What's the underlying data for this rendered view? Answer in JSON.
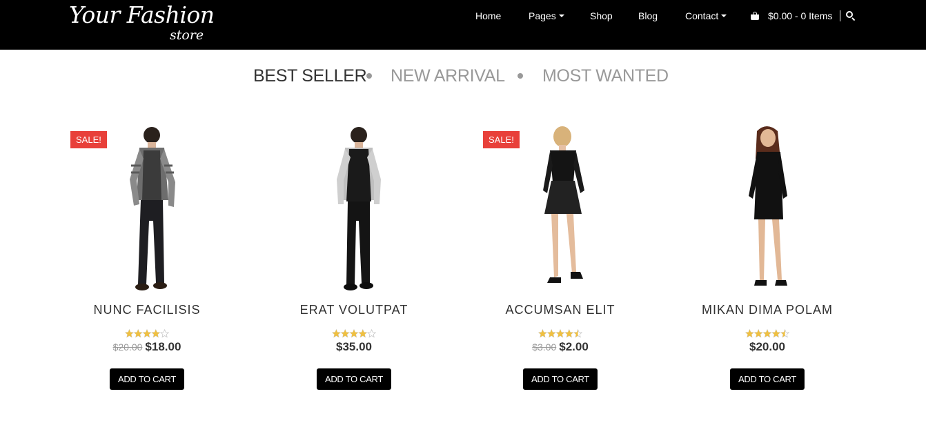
{
  "brand": {
    "logo_main": "Your Fashion",
    "logo_sub": "store"
  },
  "nav": {
    "home": "Home",
    "pages": "Pages",
    "shop": "Shop",
    "blog": "Blog",
    "contact": "Contact"
  },
  "cart": {
    "summary": "$0.00 - 0 Items"
  },
  "tabs": {
    "best_seller": "BEST SELLER",
    "new_arrival": "NEW ARRIVAL",
    "most_wanted": "MOST WANTED",
    "active": "best_seller"
  },
  "products": [
    {
      "name": "NUNC FACILISIS",
      "sale_badge": "SALE!",
      "old_price": "$20.00",
      "price": "$18.00",
      "rating": 4,
      "button": "ADD TO CART"
    },
    {
      "name": "ERAT VOLUTPAT",
      "sale_badge": "",
      "old_price": "",
      "price": "$35.00",
      "rating": 4,
      "button": "ADD TO CART"
    },
    {
      "name": "ACCUMSAN ELIT",
      "sale_badge": "SALE!",
      "old_price": "$3.00",
      "price": "$2.00",
      "rating": 4.5,
      "button": "ADD TO CART"
    },
    {
      "name": "MIKAN DIMA POLAM",
      "sale_badge": "",
      "old_price": "",
      "price": "$20.00",
      "rating": 4.5,
      "button": "ADD TO CART"
    }
  ],
  "colors": {
    "header_bg": "#000000",
    "sale_badge": "#e8403a",
    "star": "#f0c040",
    "active_tab": "#333333",
    "inactive_tab": "#999999"
  }
}
